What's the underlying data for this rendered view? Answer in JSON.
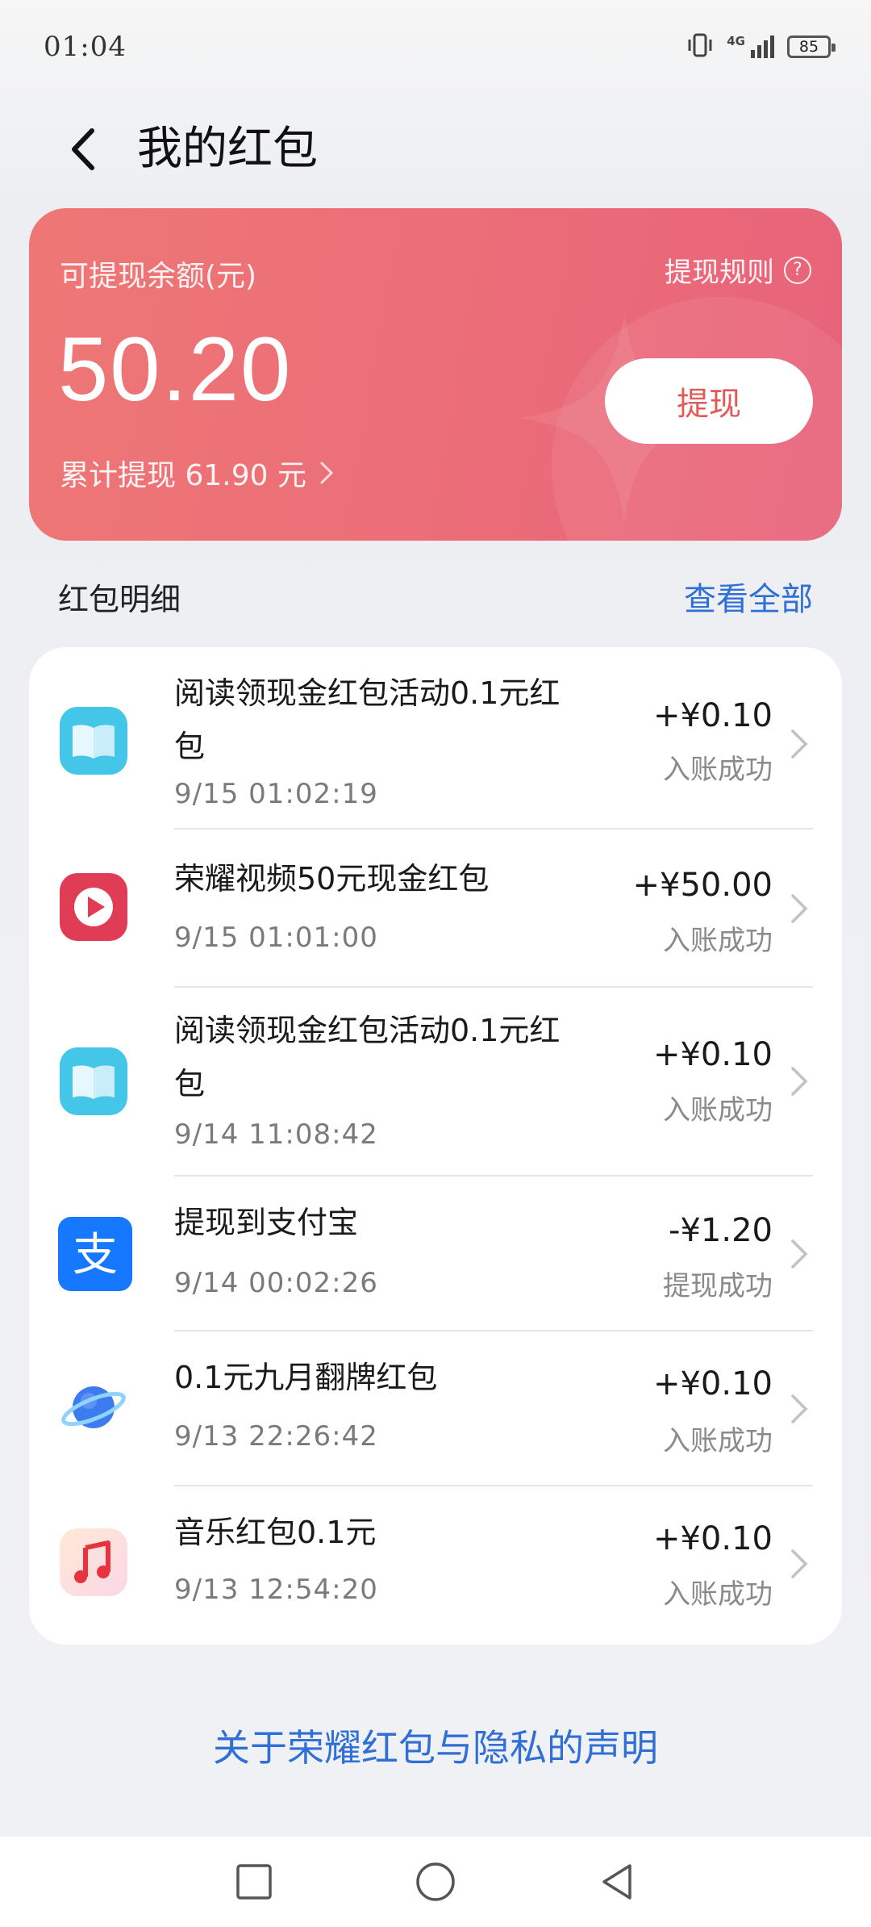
{
  "status_bar": {
    "time": "01:04",
    "network": "4G",
    "battery": "85",
    "icons": [
      "vibrate-icon",
      "signal-icon",
      "battery-icon"
    ]
  },
  "header": {
    "back_icon": "back-arrow-icon",
    "title": "我的红包"
  },
  "balance_card": {
    "label": "可提现余额(元)",
    "rules_label": "提现规则",
    "help_icon": "?",
    "amount": "50.20",
    "total_withdrawn": "累计提现 61.90 元",
    "withdraw_label": "提现"
  },
  "details": {
    "title": "红包明细",
    "view_all": "查看全部",
    "items": [
      {
        "icon": "book-app-icon",
        "title": "阅读领现金红包活动0.1元红包",
        "time": "9/15 01:02:19",
        "amount": "+¥0.10",
        "status": "入账成功"
      },
      {
        "icon": "video-app-icon",
        "title": "荣耀视频50元现金红包",
        "time": "9/15 01:01:00",
        "amount": "+¥50.00",
        "status": "入账成功"
      },
      {
        "icon": "book-app-icon",
        "title": "阅读领现金红包活动0.1元红包",
        "time": "9/14 11:08:42",
        "amount": "+¥0.10",
        "status": "入账成功"
      },
      {
        "icon": "alipay-icon",
        "title": "提现到支付宝",
        "time": "9/14 00:02:26",
        "amount": "-¥1.20",
        "status": "提现成功"
      },
      {
        "icon": "planet-icon",
        "title": "0.1元九月翻牌红包",
        "time": "9/13 22:26:42",
        "amount": "+¥0.10",
        "status": "入账成功"
      },
      {
        "icon": "music-app-icon",
        "title": "音乐红包0.1元",
        "time": "9/13 12:54:20",
        "amount": "+¥0.10",
        "status": "入账成功"
      }
    ]
  },
  "privacy_link": "关于荣耀红包与隐私的声明",
  "nav_bar": {
    "icons": [
      "recent-apps-icon",
      "home-icon",
      "back-icon"
    ]
  },
  "colors": {
    "card_gradient_start": "#ee7775",
    "card_gradient_end": "#e8637a",
    "link_blue": "#2f6fd6",
    "withdraw_text": "#e25a57"
  }
}
